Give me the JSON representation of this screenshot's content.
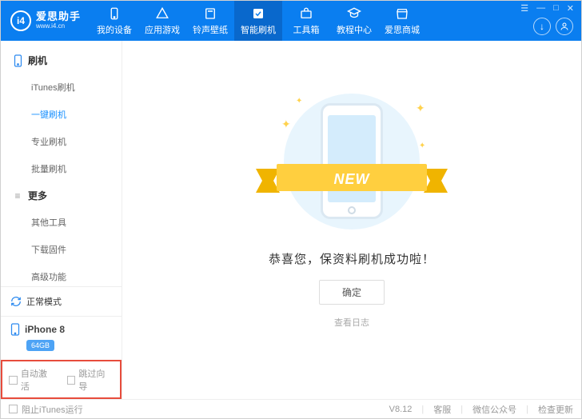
{
  "app": {
    "logo_letters": "i4",
    "title": "爱思助手",
    "subtitle": "www.i4.cn"
  },
  "window_controls": {
    "menu": "☰",
    "min": "—",
    "max": "□",
    "close": "✕"
  },
  "nav": [
    {
      "id": "my-device",
      "label": "我的设备"
    },
    {
      "id": "apps-games",
      "label": "应用游戏"
    },
    {
      "id": "ring-wall",
      "label": "铃声壁纸"
    },
    {
      "id": "smart-flash",
      "label": "智能刷机",
      "active": true
    },
    {
      "id": "toolbox",
      "label": "工具箱"
    },
    {
      "id": "tutorial",
      "label": "教程中心"
    },
    {
      "id": "store",
      "label": "爱思商城"
    }
  ],
  "header_right": {
    "download": "↓",
    "user": "◯"
  },
  "sidebar": {
    "groups": [
      {
        "id": "flash",
        "title": "刷机",
        "items": [
          {
            "id": "itunes-flash",
            "label": "iTunes刷机"
          },
          {
            "id": "onekey-flash",
            "label": "一键刷机",
            "active": true
          },
          {
            "id": "pro-flash",
            "label": "专业刷机"
          },
          {
            "id": "batch-flash",
            "label": "批量刷机"
          }
        ]
      },
      {
        "id": "more",
        "title": "更多",
        "items": [
          {
            "id": "other-tools",
            "label": "其他工具"
          },
          {
            "id": "download-fw",
            "label": "下载固件"
          },
          {
            "id": "advanced",
            "label": "高级功能"
          }
        ]
      }
    ],
    "status": {
      "label": "正常模式"
    },
    "device": {
      "name": "iPhone 8",
      "storage": "64GB"
    },
    "bottom_opts": [
      {
        "id": "auto-activate",
        "label": "自动激活"
      },
      {
        "id": "skip-wizard",
        "label": "跳过向导"
      }
    ]
  },
  "main": {
    "ribbon": "NEW",
    "success": "恭喜您，保资料刷机成功啦！",
    "confirm": "确定",
    "view_log": "查看日志"
  },
  "footer": {
    "block_itunes": "阻止iTunes运行",
    "version": "V8.12",
    "support": "客服",
    "wechat": "微信公众号",
    "check_update": "检查更新"
  }
}
